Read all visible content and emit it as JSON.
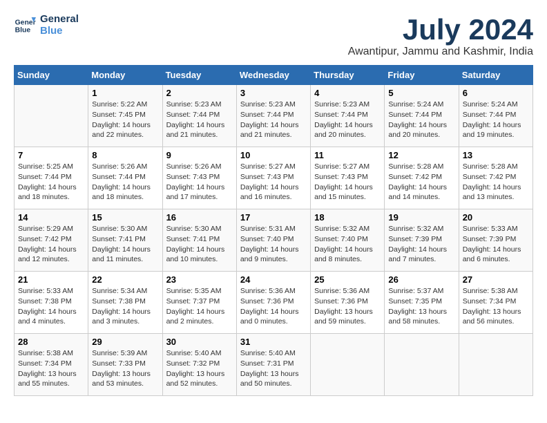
{
  "logo": {
    "line1": "General",
    "line2": "Blue"
  },
  "title": "July 2024",
  "subtitle": "Awantipur, Jammu and Kashmir, India",
  "days_of_week": [
    "Sunday",
    "Monday",
    "Tuesday",
    "Wednesday",
    "Thursday",
    "Friday",
    "Saturday"
  ],
  "weeks": [
    [
      {
        "day": "",
        "info": ""
      },
      {
        "day": "1",
        "info": "Sunrise: 5:22 AM\nSunset: 7:45 PM\nDaylight: 14 hours\nand 22 minutes."
      },
      {
        "day": "2",
        "info": "Sunrise: 5:23 AM\nSunset: 7:44 PM\nDaylight: 14 hours\nand 21 minutes."
      },
      {
        "day": "3",
        "info": "Sunrise: 5:23 AM\nSunset: 7:44 PM\nDaylight: 14 hours\nand 21 minutes."
      },
      {
        "day": "4",
        "info": "Sunrise: 5:23 AM\nSunset: 7:44 PM\nDaylight: 14 hours\nand 20 minutes."
      },
      {
        "day": "5",
        "info": "Sunrise: 5:24 AM\nSunset: 7:44 PM\nDaylight: 14 hours\nand 20 minutes."
      },
      {
        "day": "6",
        "info": "Sunrise: 5:24 AM\nSunset: 7:44 PM\nDaylight: 14 hours\nand 19 minutes."
      }
    ],
    [
      {
        "day": "7",
        "info": "Sunrise: 5:25 AM\nSunset: 7:44 PM\nDaylight: 14 hours\nand 18 minutes."
      },
      {
        "day": "8",
        "info": "Sunrise: 5:26 AM\nSunset: 7:44 PM\nDaylight: 14 hours\nand 18 minutes."
      },
      {
        "day": "9",
        "info": "Sunrise: 5:26 AM\nSunset: 7:43 PM\nDaylight: 14 hours\nand 17 minutes."
      },
      {
        "day": "10",
        "info": "Sunrise: 5:27 AM\nSunset: 7:43 PM\nDaylight: 14 hours\nand 16 minutes."
      },
      {
        "day": "11",
        "info": "Sunrise: 5:27 AM\nSunset: 7:43 PM\nDaylight: 14 hours\nand 15 minutes."
      },
      {
        "day": "12",
        "info": "Sunrise: 5:28 AM\nSunset: 7:42 PM\nDaylight: 14 hours\nand 14 minutes."
      },
      {
        "day": "13",
        "info": "Sunrise: 5:28 AM\nSunset: 7:42 PM\nDaylight: 14 hours\nand 13 minutes."
      }
    ],
    [
      {
        "day": "14",
        "info": "Sunrise: 5:29 AM\nSunset: 7:42 PM\nDaylight: 14 hours\nand 12 minutes."
      },
      {
        "day": "15",
        "info": "Sunrise: 5:30 AM\nSunset: 7:41 PM\nDaylight: 14 hours\nand 11 minutes."
      },
      {
        "day": "16",
        "info": "Sunrise: 5:30 AM\nSunset: 7:41 PM\nDaylight: 14 hours\nand 10 minutes."
      },
      {
        "day": "17",
        "info": "Sunrise: 5:31 AM\nSunset: 7:40 PM\nDaylight: 14 hours\nand 9 minutes."
      },
      {
        "day": "18",
        "info": "Sunrise: 5:32 AM\nSunset: 7:40 PM\nDaylight: 14 hours\nand 8 minutes."
      },
      {
        "day": "19",
        "info": "Sunrise: 5:32 AM\nSunset: 7:39 PM\nDaylight: 14 hours\nand 7 minutes."
      },
      {
        "day": "20",
        "info": "Sunrise: 5:33 AM\nSunset: 7:39 PM\nDaylight: 14 hours\nand 6 minutes."
      }
    ],
    [
      {
        "day": "21",
        "info": "Sunrise: 5:33 AM\nSunset: 7:38 PM\nDaylight: 14 hours\nand 4 minutes."
      },
      {
        "day": "22",
        "info": "Sunrise: 5:34 AM\nSunset: 7:38 PM\nDaylight: 14 hours\nand 3 minutes."
      },
      {
        "day": "23",
        "info": "Sunrise: 5:35 AM\nSunset: 7:37 PM\nDaylight: 14 hours\nand 2 minutes."
      },
      {
        "day": "24",
        "info": "Sunrise: 5:36 AM\nSunset: 7:36 PM\nDaylight: 14 hours\nand 0 minutes."
      },
      {
        "day": "25",
        "info": "Sunrise: 5:36 AM\nSunset: 7:36 PM\nDaylight: 13 hours\nand 59 minutes."
      },
      {
        "day": "26",
        "info": "Sunrise: 5:37 AM\nSunset: 7:35 PM\nDaylight: 13 hours\nand 58 minutes."
      },
      {
        "day": "27",
        "info": "Sunrise: 5:38 AM\nSunset: 7:34 PM\nDaylight: 13 hours\nand 56 minutes."
      }
    ],
    [
      {
        "day": "28",
        "info": "Sunrise: 5:38 AM\nSunset: 7:34 PM\nDaylight: 13 hours\nand 55 minutes."
      },
      {
        "day": "29",
        "info": "Sunrise: 5:39 AM\nSunset: 7:33 PM\nDaylight: 13 hours\nand 53 minutes."
      },
      {
        "day": "30",
        "info": "Sunrise: 5:40 AM\nSunset: 7:32 PM\nDaylight: 13 hours\nand 52 minutes."
      },
      {
        "day": "31",
        "info": "Sunrise: 5:40 AM\nSunset: 7:31 PM\nDaylight: 13 hours\nand 50 minutes."
      },
      {
        "day": "",
        "info": ""
      },
      {
        "day": "",
        "info": ""
      },
      {
        "day": "",
        "info": ""
      }
    ]
  ]
}
